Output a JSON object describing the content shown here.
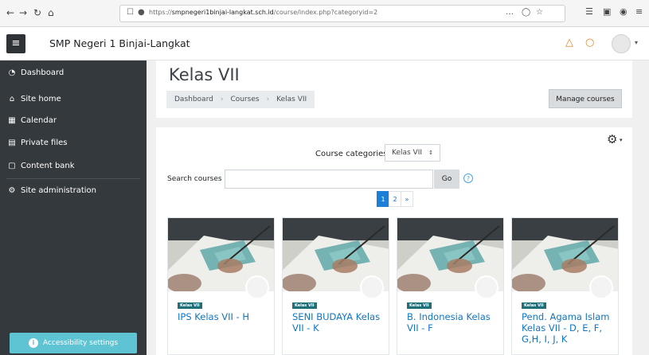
{
  "browser": {
    "url_prefix": "https://",
    "url_host": "smpnegeri1binjai-langkat.sch.id",
    "url_path": "/course/index.php?categoryid=2",
    "menu_dots": "…",
    "back_glyph": "←",
    "forward_glyph": "→",
    "reload_glyph": "↻",
    "home_glyph": "⌂"
  },
  "navbar": {
    "site_name": "SMP Negeri 1 Binjai-Langkat",
    "menu_glyph": "≡",
    "notification_glyph": "△",
    "message_glyph": "○",
    "caret": "▾"
  },
  "sidebar": {
    "items": [
      {
        "label": "Dashboard",
        "icon": "dashboard-icon",
        "glyph": "◔"
      },
      {
        "label": "Site home",
        "icon": "home-icon",
        "glyph": "⌂"
      },
      {
        "label": "Calendar",
        "icon": "calendar-icon",
        "glyph": "▦"
      },
      {
        "label": "Private files",
        "icon": "files-icon",
        "glyph": "▤"
      },
      {
        "label": "Content bank",
        "icon": "content-bank-icon",
        "glyph": "▢"
      },
      {
        "label": "Site administration",
        "icon": "gear-icon",
        "glyph": "⚙"
      }
    ],
    "accessibility_label": "Accessibility settings",
    "accessibility_glyph": "i"
  },
  "page": {
    "title": "Kelas VII",
    "breadcrumb": [
      "Dashboard",
      "Courses",
      "Kelas VII"
    ],
    "manage_label": "Manage courses"
  },
  "filters": {
    "category_label": "Course categories:",
    "category_value": "Kelas VII",
    "category_caret": "↕",
    "search_label": "Search courses",
    "search_value": "",
    "go_label": "Go",
    "help_glyph": "?",
    "gear_glyph": "⚙",
    "gear_caret": "▾"
  },
  "pagination": {
    "pages": [
      "1",
      "2",
      "»"
    ],
    "active": "1"
  },
  "courses": [
    {
      "badge": "Kelas VII",
      "name": "IPS Kelas VII - H"
    },
    {
      "badge": "Kelas VII",
      "name": "SENI BUDAYA Kelas VII - K"
    },
    {
      "badge": "Kelas VII",
      "name": "B. Indonesia Kelas VII - F"
    },
    {
      "badge": "Kelas VII",
      "name": "Pend. Agama Islam Kelas VII - D, E, F, G,H, I, J, K"
    }
  ],
  "colors": {
    "sidebar_bg": "#34393e",
    "accent_blue": "#1275c4",
    "accessibility": "#5ec3d3",
    "badge": "#1e6f7a",
    "notification": "#e38a2a"
  }
}
